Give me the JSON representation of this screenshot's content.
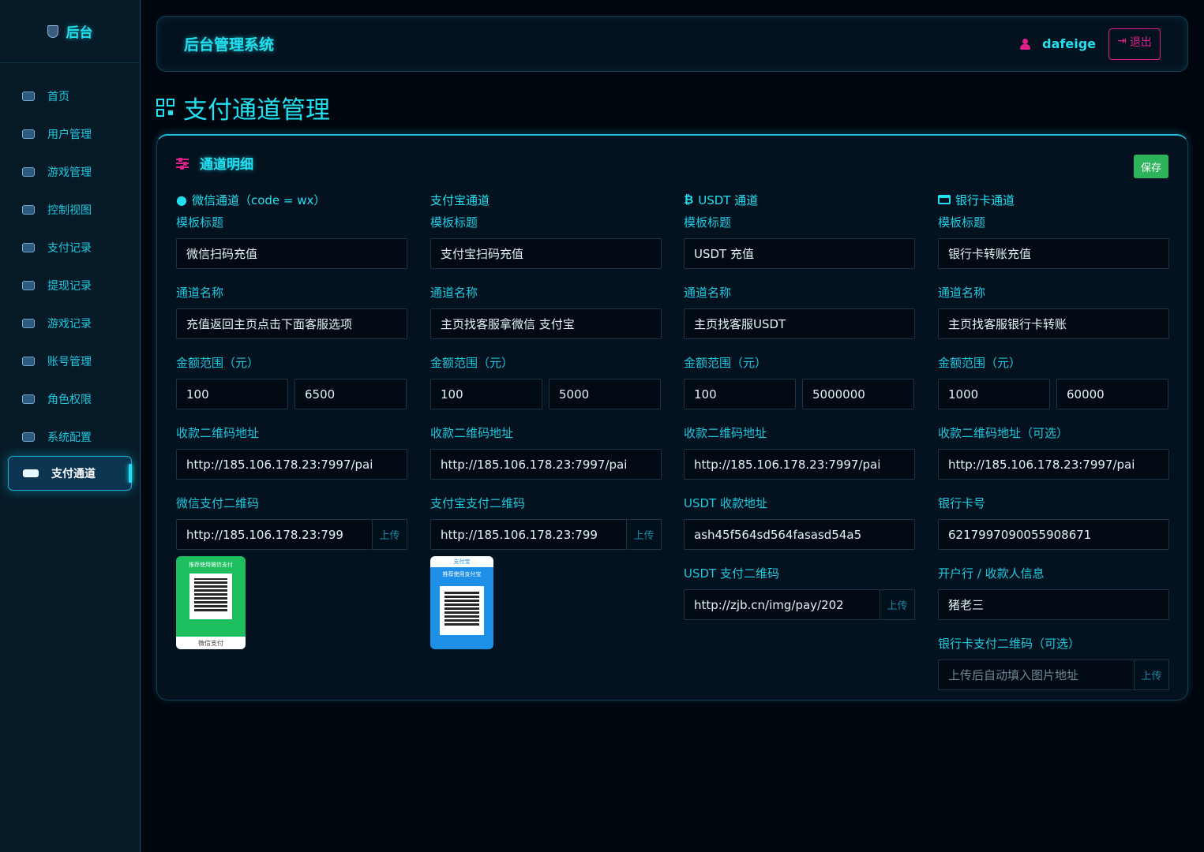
{
  "sidebar": {
    "brand": "后台",
    "items": [
      {
        "label": "首页",
        "icon": "dashboard-icon"
      },
      {
        "label": "用户管理",
        "icon": "users-icon"
      },
      {
        "label": "游戏管理",
        "icon": "gamepad-icon"
      },
      {
        "label": "控制视图",
        "icon": "sliders-icon"
      },
      {
        "label": "支付记录",
        "icon": "money-icon"
      },
      {
        "label": "提现记录",
        "icon": "money-icon"
      },
      {
        "label": "游戏记录",
        "icon": "list-icon"
      },
      {
        "label": "账号管理",
        "icon": "lock-icon"
      },
      {
        "label": "角色权限",
        "icon": "shield-icon"
      },
      {
        "label": "系统配置",
        "icon": "gear-icon"
      },
      {
        "label": "支付通道",
        "icon": "card-icon",
        "active": true
      }
    ]
  },
  "header": {
    "title": "后台管理系统",
    "username": "dafeige",
    "logout_label": "退出"
  },
  "page": {
    "title": "支付通道管理"
  },
  "panel": {
    "title": "通道明细",
    "save_label": "保存",
    "upload_label": "上传",
    "wechat": {
      "heading": "微信通道（code = wx）",
      "template_title_label": "模板标题",
      "template_title": "微信扫码充值",
      "channel_name_label": "通道名称",
      "channel_name": "充值返回主页点击下面客服选项",
      "amount_label": "金额范围（元）",
      "amount_min": "100",
      "amount_max": "6500",
      "qr_addr_label": "收款二维码地址",
      "qr_addr": "http://185.106.178.23:7997/pai",
      "pay_qr_label": "微信支付二维码",
      "pay_qr": "http://185.106.178.23:799",
      "card_caption": "推荐使用微信支付",
      "card_footer": "微信支付"
    },
    "alipay": {
      "heading": "支付宝通道",
      "template_title_label": "模板标题",
      "template_title": "支付宝扫码充值",
      "channel_name_label": "通道名称",
      "channel_name": "主页找客服拿微信 支付宝",
      "amount_label": "金额范围（元）",
      "amount_min": "100",
      "amount_max": "5000",
      "qr_addr_label": "收款二维码地址",
      "qr_addr": "http://185.106.178.23:7997/pai",
      "pay_qr_label": "支付宝支付二维码",
      "pay_qr": "http://185.106.178.23:799",
      "card_brand": "支付宝",
      "card_caption": "推荐使用支付宝"
    },
    "usdt": {
      "heading": "USDT 通道",
      "template_title_label": "模板标题",
      "template_title": "USDT 充值",
      "channel_name_label": "通道名称",
      "channel_name": "主页找客服USDT",
      "amount_label": "金额范围（元）",
      "amount_min": "100",
      "amount_max": "5000000",
      "qr_addr_label": "收款二维码地址",
      "qr_addr": "http://185.106.178.23:7997/pai",
      "wallet_label": "USDT 收款地址",
      "wallet": "ash45f564sd564fasasd54a5",
      "pay_qr_label": "USDT 支付二维码",
      "pay_qr": "http://zjb.cn/img/pay/202"
    },
    "bank": {
      "heading": "银行卡通道",
      "template_title_label": "模板标题",
      "template_title": "银行卡转账充值",
      "channel_name_label": "通道名称",
      "channel_name": "主页找客服银行卡转账",
      "amount_label": "金额范围（元）",
      "amount_min": "1000",
      "amount_max": "60000",
      "qr_addr_label": "收款二维码地址（可选）",
      "qr_addr": "http://185.106.178.23:7997/pai",
      "card_no_label": "银行卡号",
      "card_no": "6217997090055908671",
      "bank_info_label": "开户行 / 收款人信息",
      "bank_info": "猪老三",
      "pay_qr_label": "银行卡支付二维码（可选）",
      "pay_qr_placeholder": "上传后自动填入图片地址"
    }
  },
  "colors": {
    "accent": "#22e0f0",
    "danger": "#e0208a",
    "success": "#2fb35a",
    "background": "#00060d"
  }
}
